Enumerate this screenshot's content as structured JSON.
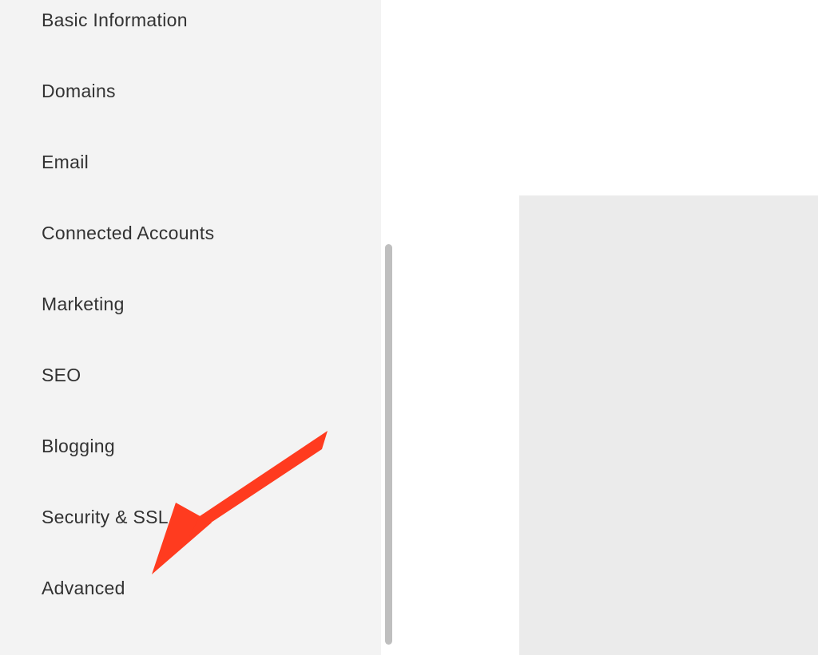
{
  "sidebar": {
    "items": [
      {
        "label": "Basic Information"
      },
      {
        "label": "Domains"
      },
      {
        "label": "Email"
      },
      {
        "label": "Connected Accounts"
      },
      {
        "label": "Marketing"
      },
      {
        "label": "SEO"
      },
      {
        "label": "Blogging"
      },
      {
        "label": "Security & SSL"
      },
      {
        "label": "Advanced"
      }
    ]
  },
  "annotation": {
    "color": "#ff3b1f"
  }
}
